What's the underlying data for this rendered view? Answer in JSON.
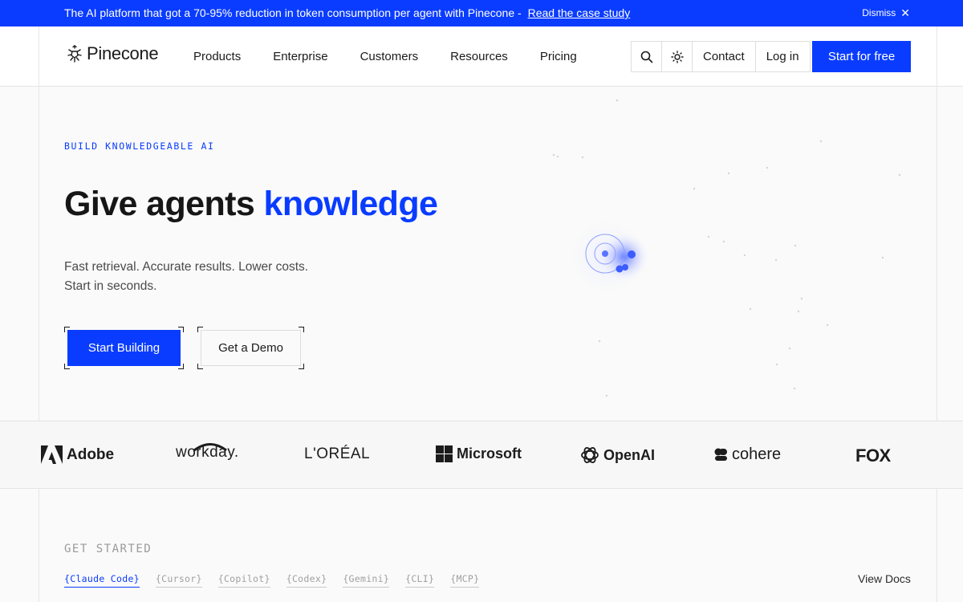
{
  "announcement": {
    "message": "The AI platform that got a 70-95% reduction in token consumption per agent with Pinecone -",
    "link": "Read the case study",
    "dismiss": "Dismiss"
  },
  "header": {
    "logo": "Pinecone",
    "nav": [
      "Products",
      "Enterprise",
      "Customers",
      "Resources",
      "Pricing"
    ],
    "contact": "Contact",
    "login": "Log in",
    "cta": "Start for free"
  },
  "hero": {
    "eyebrow": "BUILD KNOWLEDGEABLE AI",
    "headline_plain": "Give agents",
    "headline_accent": "knowledge",
    "sub_line1": "Fast retrieval. Accurate results. Lower costs.",
    "sub_line2": "Start in seconds.",
    "primary_button": "Start Building",
    "secondary_button": "Get a Demo"
  },
  "logos": [
    "Adobe",
    "workday.",
    "L'ORÉAL",
    "Microsoft",
    "OpenAI",
    "cohere",
    "FOX"
  ],
  "get_started": {
    "title": "GET STARTED",
    "tabs": [
      "{Claude Code}",
      "{Cursor}",
      "{Copilot}",
      "{Codex}",
      "{Gemini}",
      "{CLI}",
      "{MCP}"
    ],
    "active_tab": "{Claude Code}",
    "view_docs": "View Docs"
  },
  "colors": {
    "brand_blue": "#0a3cff"
  }
}
